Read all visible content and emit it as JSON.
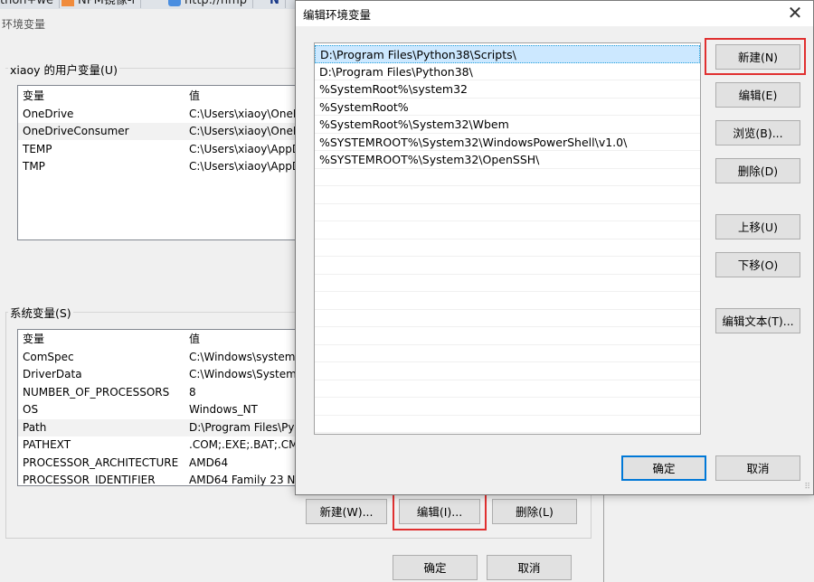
{
  "browser_tabs": [
    {
      "label": "thon+we"
    },
    {
      "label": "NPM镜像-i"
    },
    {
      "label": "http://nmp"
    },
    {
      "label": "N"
    }
  ],
  "env_window": {
    "title": "环境变量",
    "user_group_label": "xiaoy 的用户变量(U)",
    "user_vars": {
      "col_name": "变量",
      "col_value": "值",
      "rows": [
        {
          "name": "OneDrive",
          "value": "C:\\Users\\xiaoy\\OneD"
        },
        {
          "name": "OneDriveConsumer",
          "value": "C:\\Users\\xiaoy\\OneD"
        },
        {
          "name": "TEMP",
          "value": "C:\\Users\\xiaoy\\AppD"
        },
        {
          "name": "TMP",
          "value": "C:\\Users\\xiaoy\\AppD"
        }
      ]
    },
    "system_group_label": "系统变量(S)",
    "system_vars": {
      "col_name": "变量",
      "col_value": "值",
      "rows": [
        {
          "name": "ComSpec",
          "value": "C:\\Windows\\system"
        },
        {
          "name": "DriverData",
          "value": "C:\\Windows\\System"
        },
        {
          "name": "NUMBER_OF_PROCESSORS",
          "value": "8"
        },
        {
          "name": "OS",
          "value": "Windows_NT"
        },
        {
          "name": "Path",
          "value": "D:\\Program Files\\Py"
        },
        {
          "name": "PATHEXT",
          "value": ".COM;.EXE;.BAT;.CM"
        },
        {
          "name": "PROCESSOR_ARCHITECTURE",
          "value": "AMD64"
        },
        {
          "name": "PROCESSOR_IDENTIFIER",
          "value": "AMD64 Family 23 N"
        }
      ]
    },
    "buttons": {
      "new": "新建(W)...",
      "edit": "编辑(I)...",
      "delete": "删除(L)",
      "ok": "确定",
      "cancel": "取消"
    }
  },
  "edit_dialog": {
    "title": "编辑环境变量",
    "close_glyph": "✕",
    "entries": [
      "D:\\Program Files\\Python38\\Scripts\\",
      "D:\\Program Files\\Python38\\",
      "%SystemRoot%\\system32",
      "%SystemRoot%",
      "%SystemRoot%\\System32\\Wbem",
      "%SYSTEMROOT%\\System32\\WindowsPowerShell\\v1.0\\",
      "%SYSTEMROOT%\\System32\\OpenSSH\\"
    ],
    "buttons": {
      "new": "新建(N)",
      "edit": "编辑(E)",
      "browse": "浏览(B)...",
      "delete": "删除(D)",
      "move_up": "上移(U)",
      "move_down": "下移(O)",
      "edit_text": "编辑文本(T)...",
      "ok": "确定",
      "cancel": "取消"
    }
  },
  "colors": {
    "highlight_box": "#e03030",
    "selection": "#cce8ff",
    "accent": "#0078d7"
  }
}
